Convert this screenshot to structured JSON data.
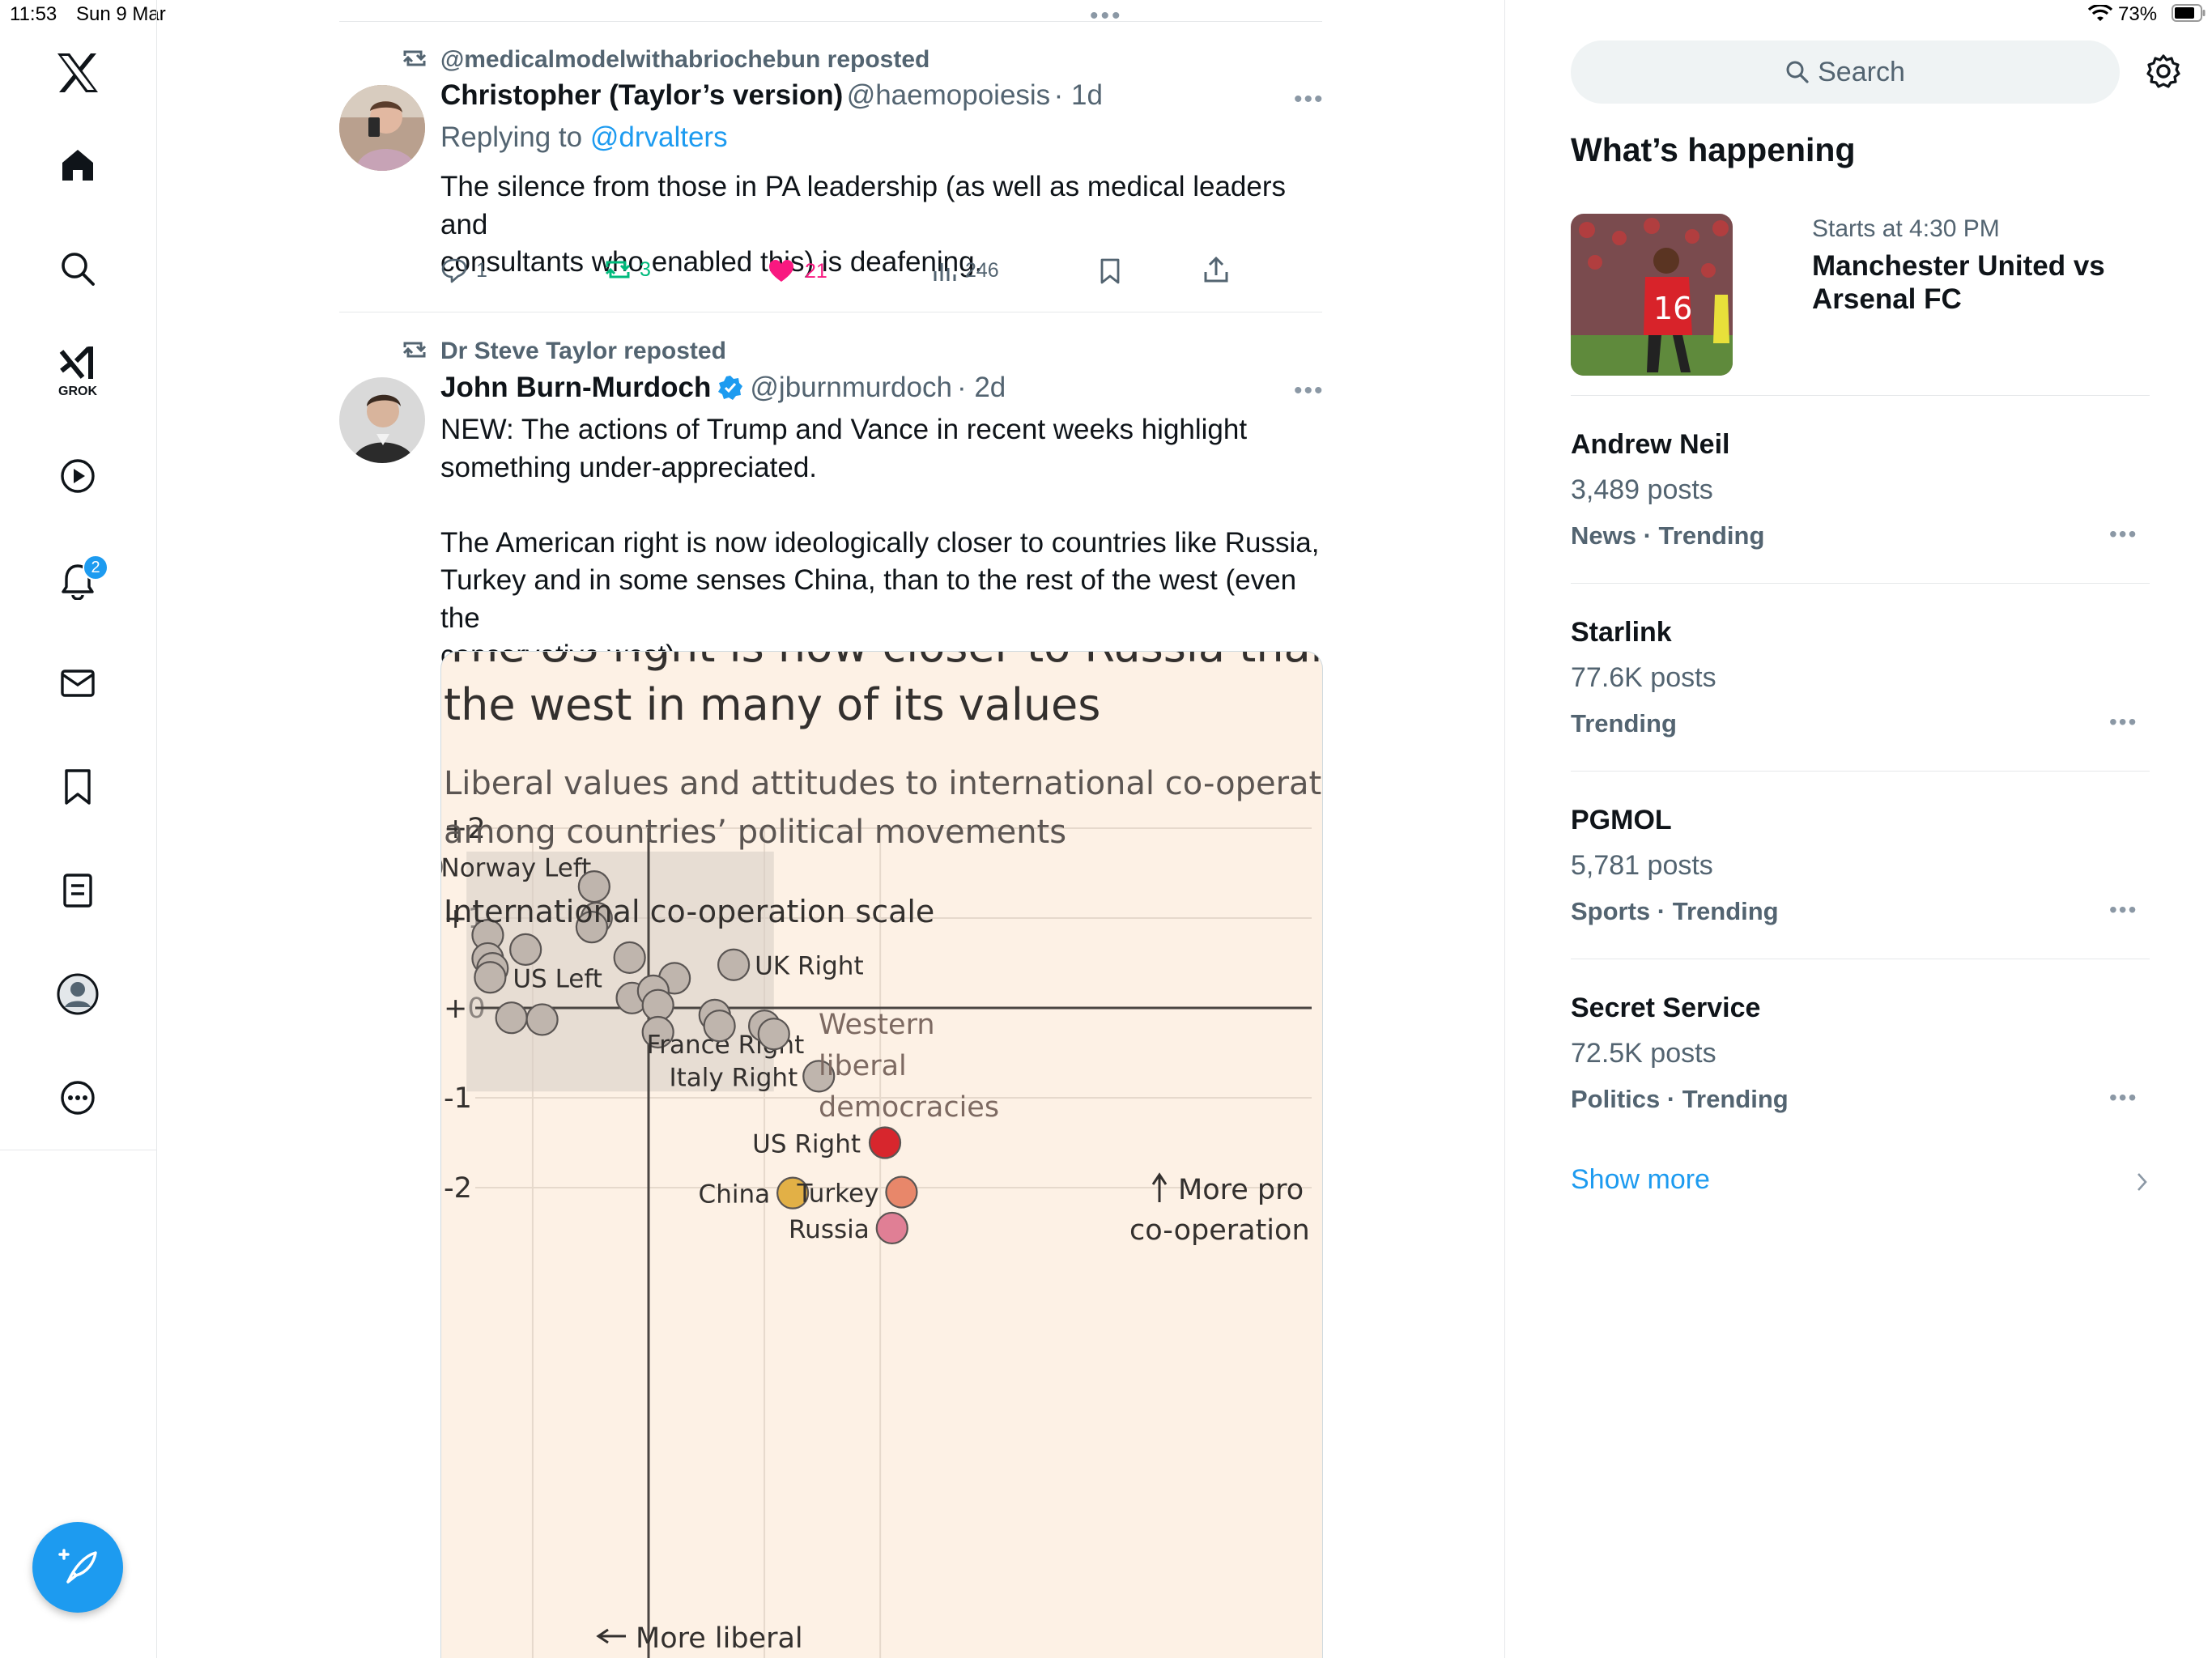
{
  "status_bar": {
    "time": "11:53",
    "date": "Sun 9 Mar",
    "battery": "73%"
  },
  "nav": {
    "notification_badge": "2",
    "grok_label": "GROK"
  },
  "tweets": [
    {
      "reposted_by": "@medicalmodelwithabriochebun reposted",
      "display_name": "Christopher (Taylor’s version)",
      "handle": "@haemopoiesis",
      "time": "· 1d",
      "replying_prefix": "Replying to",
      "replying_to": "@drvalters",
      "text_lines": [
        "The silence from those in PA leadership (as well as medical leaders and",
        "consultants who enabled this) is deafening."
      ],
      "replies": "1",
      "reposts": "3",
      "likes": "21",
      "views": "246"
    },
    {
      "reposted_by": "Dr Steve Taylor reposted",
      "display_name": "John Burn-Murdoch",
      "handle": "@jburnmurdoch",
      "time": "· 2d",
      "text_lines": [
        "NEW: The actions of Trump and Vance in recent weeks highlight",
        "something under-appreciated.",
        "",
        "The American right is now ideologically closer to countries like Russia,",
        "Turkey and in some senses China, than to the rest of the west (even the",
        "conservative west)."
      ]
    }
  ],
  "chart_data": {
    "type": "scatter",
    "title_lines": [
      "The US right is now closer to Russia than",
      "the west in many of its values"
    ],
    "subtitle_lines": [
      "Liberal values and attitudes to international co-operation",
      "among countries’ political movements"
    ],
    "ylabel": "International co-operation scale",
    "yticks": [
      "+2",
      "+1",
      "+0",
      "-1",
      "-2"
    ],
    "ylim": [
      -2.6,
      2.2
    ],
    "xlim": [
      -1.0,
      1.0
    ],
    "shaded_region_label_lines": [
      "Western",
      "liberal",
      "democracies"
    ],
    "annotation_right_lines": [
      "More pro",
      "co-operation"
    ],
    "annotation_bottom": "More liberal",
    "points": [
      {
        "label": "Norway Left",
        "x": -0.94,
        "y": 1.57,
        "color": "#bfb5ad"
      },
      {
        "label": "",
        "x": -0.95,
        "y": 0.99,
        "color": "#bfb5ad"
      },
      {
        "label": "",
        "x": -0.23,
        "y": 1.35,
        "color": "#bfb5ad"
      },
      {
        "label": "",
        "x": -0.22,
        "y": 1.0,
        "color": "#bfb5ad"
      },
      {
        "label": "",
        "x": -0.24,
        "y": 0.9,
        "color": "#bfb5ad"
      },
      {
        "label": "",
        "x": -0.68,
        "y": 0.81,
        "color": "#bfb5ad"
      },
      {
        "label": "",
        "x": -0.68,
        "y": 0.55,
        "color": "#bfb5ad"
      },
      {
        "label": "",
        "x": -0.52,
        "y": 0.65,
        "color": "#bfb5ad"
      },
      {
        "label": "",
        "x": -0.66,
        "y": 0.44,
        "color": "#bfb5ad"
      },
      {
        "label": "US Left",
        "x": -0.67,
        "y": 0.34,
        "color": "#bfb5ad"
      },
      {
        "label": "",
        "x": -0.08,
        "y": 0.56,
        "color": "#bfb5ad"
      },
      {
        "label": "",
        "x": -0.07,
        "y": 0.11,
        "color": "#bfb5ad"
      },
      {
        "label": "",
        "x": 0.11,
        "y": 0.33,
        "color": "#bfb5ad"
      },
      {
        "label": "",
        "x": 0.02,
        "y": 0.19,
        "color": "#bfb5ad"
      },
      {
        "label": "",
        "x": 0.04,
        "y": 0.03,
        "color": "#bfb5ad"
      },
      {
        "label": "UK Right",
        "x": 0.36,
        "y": 0.48,
        "color": "#bfb5ad"
      },
      {
        "label": "",
        "x": -0.58,
        "y": -0.11,
        "color": "#bfb5ad"
      },
      {
        "label": "",
        "x": -0.45,
        "y": -0.13,
        "color": "#bfb5ad"
      },
      {
        "label": "France Right",
        "x": 0.04,
        "y": -0.27,
        "color": "#bfb5ad"
      },
      {
        "label": "",
        "x": 0.28,
        "y": -0.08,
        "color": "#bfb5ad"
      },
      {
        "label": "",
        "x": 0.3,
        "y": -0.2,
        "color": "#bfb5ad"
      },
      {
        "label": "",
        "x": 0.49,
        "y": -0.2,
        "color": "#bfb5ad"
      },
      {
        "label": "",
        "x": 0.53,
        "y": -0.29,
        "color": "#bfb5ad"
      },
      {
        "label": "Italy Right",
        "x": 0.72,
        "y": -0.76,
        "color": "#bfb5ad"
      },
      {
        "label": "US Right",
        "x": 1.0,
        "y": -1.5,
        "color": "#d7262d"
      },
      {
        "label": "China",
        "x": 0.61,
        "y": -2.06,
        "color": "#e2b046"
      },
      {
        "label": "Turkey",
        "x": 1.07,
        "y": -2.05,
        "color": "#e8876a"
      },
      {
        "label": "Russia",
        "x": 1.03,
        "y": -2.45,
        "color": "#e07f95"
      }
    ]
  },
  "search": {
    "placeholder": "Search"
  },
  "whats_happening": {
    "title": "What’s happening",
    "event": {
      "time": "Starts at 4:30 PM",
      "title_lines": [
        "Manchester United vs",
        "Arsenal FC"
      ]
    }
  },
  "trends": [
    {
      "name": "Andrew Neil",
      "count": "3,489 posts",
      "context": "News · Trending"
    },
    {
      "name": "Starlink",
      "count": "77.6K posts",
      "context": "Trending"
    },
    {
      "name": "PGMOL",
      "count": "5,781 posts",
      "context": "Sports · Trending"
    },
    {
      "name": "Secret Service",
      "count": "72.5K posts",
      "context": "Politics · Trending"
    }
  ],
  "show_more": "Show more",
  "colors": {
    "x_black": "#0f1419",
    "link_blue": "#1d9bf0",
    "like_pink": "#f91880",
    "repost_green": "#00ba7c",
    "muted_gray": "#536471",
    "chart_bg": "#fdf1e5"
  }
}
